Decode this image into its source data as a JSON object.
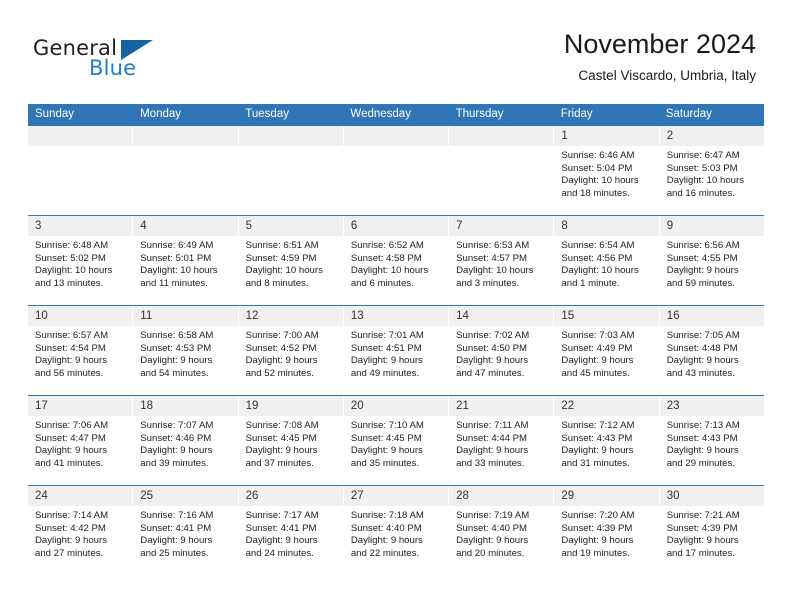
{
  "brand": {
    "name_part1": "General",
    "name_part2": "Blue",
    "triangle_color": "#1464a5",
    "blue_color": "#1f7fc4"
  },
  "header": {
    "title": "November 2024",
    "subtitle": "Castel Viscardo, Umbria, Italy"
  },
  "theme": {
    "header_blue": "#3075b5",
    "daynumber_gray": "#f0f0f0",
    "text_color": "#222222"
  },
  "weekdays": [
    "Sunday",
    "Monday",
    "Tuesday",
    "Wednesday",
    "Thursday",
    "Friday",
    "Saturday"
  ],
  "labels": {
    "sunrise_prefix": "Sunrise:",
    "sunset_prefix": "Sunset:",
    "daylight_prefix": "Daylight:"
  },
  "weeks": [
    [
      {
        "empty": true
      },
      {
        "empty": true
      },
      {
        "empty": true
      },
      {
        "empty": true
      },
      {
        "empty": true
      },
      {
        "day": "1",
        "sunrise": "Sunrise: 6:46 AM",
        "sunset": "Sunset: 5:04 PM",
        "daylight_1": "Daylight: 10 hours",
        "daylight_2": "and 18 minutes."
      },
      {
        "day": "2",
        "sunrise": "Sunrise: 6:47 AM",
        "sunset": "Sunset: 5:03 PM",
        "daylight_1": "Daylight: 10 hours",
        "daylight_2": "and 16 minutes."
      }
    ],
    [
      {
        "day": "3",
        "sunrise": "Sunrise: 6:48 AM",
        "sunset": "Sunset: 5:02 PM",
        "daylight_1": "Daylight: 10 hours",
        "daylight_2": "and 13 minutes."
      },
      {
        "day": "4",
        "sunrise": "Sunrise: 6:49 AM",
        "sunset": "Sunset: 5:01 PM",
        "daylight_1": "Daylight: 10 hours",
        "daylight_2": "and 11 minutes."
      },
      {
        "day": "5",
        "sunrise": "Sunrise: 6:51 AM",
        "sunset": "Sunset: 4:59 PM",
        "daylight_1": "Daylight: 10 hours",
        "daylight_2": "and 8 minutes."
      },
      {
        "day": "6",
        "sunrise": "Sunrise: 6:52 AM",
        "sunset": "Sunset: 4:58 PM",
        "daylight_1": "Daylight: 10 hours",
        "daylight_2": "and 6 minutes."
      },
      {
        "day": "7",
        "sunrise": "Sunrise: 6:53 AM",
        "sunset": "Sunset: 4:57 PM",
        "daylight_1": "Daylight: 10 hours",
        "daylight_2": "and 3 minutes."
      },
      {
        "day": "8",
        "sunrise": "Sunrise: 6:54 AM",
        "sunset": "Sunset: 4:56 PM",
        "daylight_1": "Daylight: 10 hours",
        "daylight_2": "and 1 minute."
      },
      {
        "day": "9",
        "sunrise": "Sunrise: 6:56 AM",
        "sunset": "Sunset: 4:55 PM",
        "daylight_1": "Daylight: 9 hours",
        "daylight_2": "and 59 minutes."
      }
    ],
    [
      {
        "day": "10",
        "sunrise": "Sunrise: 6:57 AM",
        "sunset": "Sunset: 4:54 PM",
        "daylight_1": "Daylight: 9 hours",
        "daylight_2": "and 56 minutes."
      },
      {
        "day": "11",
        "sunrise": "Sunrise: 6:58 AM",
        "sunset": "Sunset: 4:53 PM",
        "daylight_1": "Daylight: 9 hours",
        "daylight_2": "and 54 minutes."
      },
      {
        "day": "12",
        "sunrise": "Sunrise: 7:00 AM",
        "sunset": "Sunset: 4:52 PM",
        "daylight_1": "Daylight: 9 hours",
        "daylight_2": "and 52 minutes."
      },
      {
        "day": "13",
        "sunrise": "Sunrise: 7:01 AM",
        "sunset": "Sunset: 4:51 PM",
        "daylight_1": "Daylight: 9 hours",
        "daylight_2": "and 49 minutes."
      },
      {
        "day": "14",
        "sunrise": "Sunrise: 7:02 AM",
        "sunset": "Sunset: 4:50 PM",
        "daylight_1": "Daylight: 9 hours",
        "daylight_2": "and 47 minutes."
      },
      {
        "day": "15",
        "sunrise": "Sunrise: 7:03 AM",
        "sunset": "Sunset: 4:49 PM",
        "daylight_1": "Daylight: 9 hours",
        "daylight_2": "and 45 minutes."
      },
      {
        "day": "16",
        "sunrise": "Sunrise: 7:05 AM",
        "sunset": "Sunset: 4:48 PM",
        "daylight_1": "Daylight: 9 hours",
        "daylight_2": "and 43 minutes."
      }
    ],
    [
      {
        "day": "17",
        "sunrise": "Sunrise: 7:06 AM",
        "sunset": "Sunset: 4:47 PM",
        "daylight_1": "Daylight: 9 hours",
        "daylight_2": "and 41 minutes."
      },
      {
        "day": "18",
        "sunrise": "Sunrise: 7:07 AM",
        "sunset": "Sunset: 4:46 PM",
        "daylight_1": "Daylight: 9 hours",
        "daylight_2": "and 39 minutes."
      },
      {
        "day": "19",
        "sunrise": "Sunrise: 7:08 AM",
        "sunset": "Sunset: 4:45 PM",
        "daylight_1": "Daylight: 9 hours",
        "daylight_2": "and 37 minutes."
      },
      {
        "day": "20",
        "sunrise": "Sunrise: 7:10 AM",
        "sunset": "Sunset: 4:45 PM",
        "daylight_1": "Daylight: 9 hours",
        "daylight_2": "and 35 minutes."
      },
      {
        "day": "21",
        "sunrise": "Sunrise: 7:11 AM",
        "sunset": "Sunset: 4:44 PM",
        "daylight_1": "Daylight: 9 hours",
        "daylight_2": "and 33 minutes."
      },
      {
        "day": "22",
        "sunrise": "Sunrise: 7:12 AM",
        "sunset": "Sunset: 4:43 PM",
        "daylight_1": "Daylight: 9 hours",
        "daylight_2": "and 31 minutes."
      },
      {
        "day": "23",
        "sunrise": "Sunrise: 7:13 AM",
        "sunset": "Sunset: 4:43 PM",
        "daylight_1": "Daylight: 9 hours",
        "daylight_2": "and 29 minutes."
      }
    ],
    [
      {
        "day": "24",
        "sunrise": "Sunrise: 7:14 AM",
        "sunset": "Sunset: 4:42 PM",
        "daylight_1": "Daylight: 9 hours",
        "daylight_2": "and 27 minutes."
      },
      {
        "day": "25",
        "sunrise": "Sunrise: 7:16 AM",
        "sunset": "Sunset: 4:41 PM",
        "daylight_1": "Daylight: 9 hours",
        "daylight_2": "and 25 minutes."
      },
      {
        "day": "26",
        "sunrise": "Sunrise: 7:17 AM",
        "sunset": "Sunset: 4:41 PM",
        "daylight_1": "Daylight: 9 hours",
        "daylight_2": "and 24 minutes."
      },
      {
        "day": "27",
        "sunrise": "Sunrise: 7:18 AM",
        "sunset": "Sunset: 4:40 PM",
        "daylight_1": "Daylight: 9 hours",
        "daylight_2": "and 22 minutes."
      },
      {
        "day": "28",
        "sunrise": "Sunrise: 7:19 AM",
        "sunset": "Sunset: 4:40 PM",
        "daylight_1": "Daylight: 9 hours",
        "daylight_2": "and 20 minutes."
      },
      {
        "day": "29",
        "sunrise": "Sunrise: 7:20 AM",
        "sunset": "Sunset: 4:39 PM",
        "daylight_1": "Daylight: 9 hours",
        "daylight_2": "and 19 minutes."
      },
      {
        "day": "30",
        "sunrise": "Sunrise: 7:21 AM",
        "sunset": "Sunset: 4:39 PM",
        "daylight_1": "Daylight: 9 hours",
        "daylight_2": "and 17 minutes."
      }
    ]
  ]
}
